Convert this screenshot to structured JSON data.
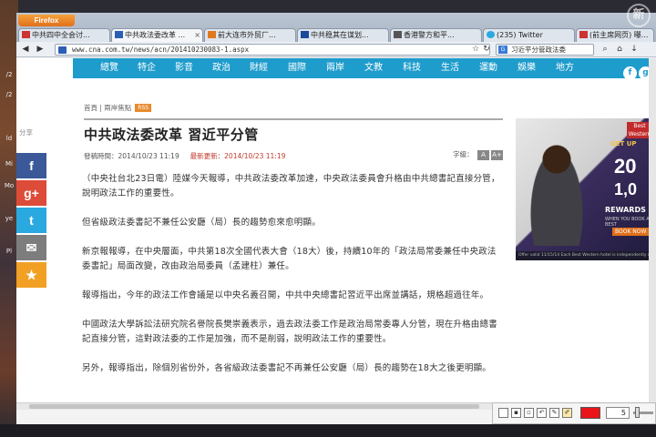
{
  "desktop": {
    "labels": [
      "/2",
      "/2",
      "ld",
      "Mi",
      "Mo",
      "ye",
      "Pl"
    ]
  },
  "browser": {
    "firefox_label": "Firefox",
    "tabs": [
      {
        "label": "中共四中全会讨..."
      },
      {
        "label": "中共政法委改革 ..."
      },
      {
        "label": "前大连市外贸厂..."
      },
      {
        "label": "中共稳其在谋划..."
      },
      {
        "label": "香港警方和平..."
      },
      {
        "label": "(235) Twitter"
      },
      {
        "label": "(前主席网页) 曝..."
      }
    ],
    "url": "www.cna.com.tw/news/acn/201410230083-1.aspx",
    "search_value": "习近平分管政法委",
    "search_engine": "G"
  },
  "site": {
    "nav_items": [
      "總覽",
      "特企",
      "影音",
      "政治",
      "財經",
      "國際",
      "兩岸",
      "文教",
      "科技",
      "生活",
      "運動",
      "娛樂",
      "地方"
    ],
    "social": [
      "f",
      "g"
    ]
  },
  "share": {
    "label": "分享",
    "buttons": [
      {
        "icon": "f",
        "color": "#3b5998"
      },
      {
        "icon": "g+",
        "color": "#dd4b39"
      },
      {
        "icon": "t",
        "color": "#2aa9e0"
      },
      {
        "icon": "✉",
        "color": "#7d7d7d"
      },
      {
        "icon": "★",
        "color": "#f2a024"
      }
    ]
  },
  "article": {
    "breadcrumb": "首頁 | 兩岸焦點",
    "badge": "RSS",
    "title": "中共政法委改革 習近平分管",
    "published": "發稿時間：2014/10/23 11:19",
    "updated": "最新更新：2014/10/23 11:19",
    "font_label": "字級：",
    "font_small": "A",
    "font_large": "A+",
    "paragraphs": [
      "（中央社台北23日電）陸媒今天報導，中共政法委改革加速，中央政法委員會升格由中共總書記直接分管，說明政法工作的重要性。",
      "但省級政法委書記不兼任公安廳（局）長的趨勢愈來愈明顯。",
      "新京報報導，在中央層面，中共第18次全國代表大會（18大）後，持續10年的「政法局常委兼任中央政法委書記」局面改變，改由政治局委員（孟建柱）兼任。",
      "報導指出，今年的政法工作會議是以中央名義召開，中共中央總書記習近平出席並講話，規格超過往年。",
      "中國政法大學訴訟法研究院名譽院長樊崇義表示，過去政法委工作是政治局常委專人分管，現在升格由總書記直接分管，這對政法委的工作是加強，而不是削弱，說明政法工作的重要性。",
      "另外，報導指出，除個別省份外，各省級政法委書記不再兼任公安廳（局）長的趨勢在18大之後更明顯。"
    ]
  },
  "ad": {
    "brand": "Best Western",
    "get_up": "GET UP",
    "big_number": "20",
    "second_number": "1,0",
    "rewards": "REWARDS",
    "sub": "WHEN YOU BOOK AT BEST",
    "book": "BOOK NOW",
    "footer": "Offer valid 11/15/14  Each Best Western hotel is independently owned"
  },
  "draw_toolbar": {
    "size_value": "5",
    "color": "#e8151b"
  },
  "watermark": "新"
}
